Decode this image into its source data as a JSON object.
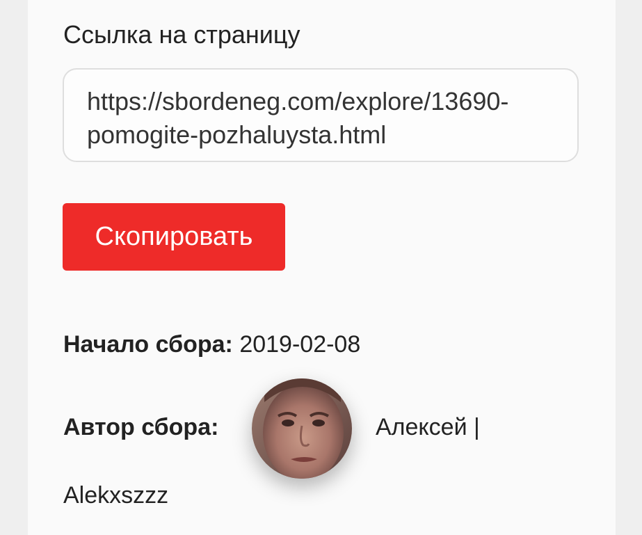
{
  "share": {
    "label": "Ссылка на страницу",
    "url": "https://sbordeneg.com/explore/13690-\npomogite-pozhaluysta.html",
    "copy_label": "Скопировать"
  },
  "details": {
    "start_label": "Начало сбора:",
    "start_value": "2019-02-08",
    "author_label": "Автор сбора:",
    "author_name": "Алексей |",
    "author_username": "Alekxszzz",
    "avatar_icon": "user-avatar-photo"
  },
  "colors": {
    "accent": "#ee2b29",
    "card_bg": "#fafafa",
    "page_bg": "#efefef",
    "text": "#222222",
    "border": "#dedede"
  }
}
